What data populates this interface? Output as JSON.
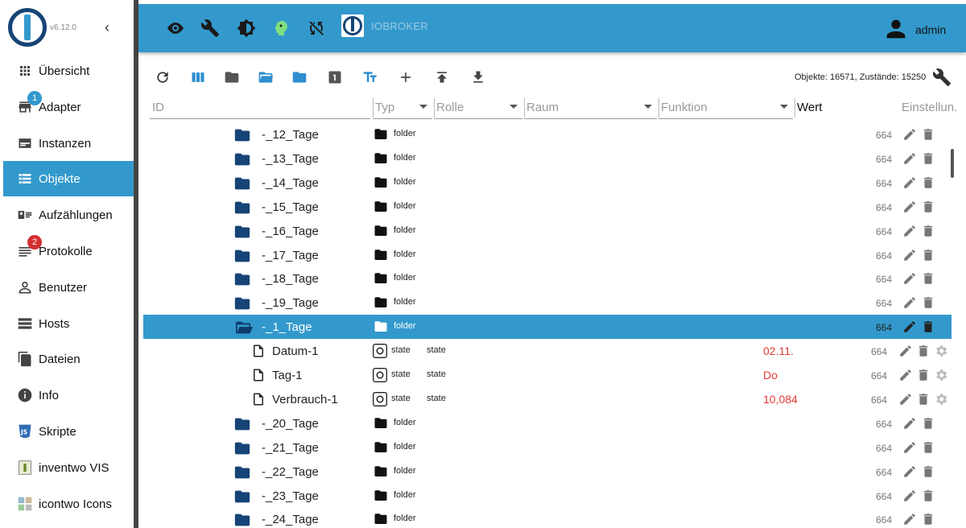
{
  "sidebar": {
    "version": "v6.12.0",
    "items": [
      {
        "label": "Übersicht",
        "icon": "grid-icon"
      },
      {
        "label": "Adapter",
        "icon": "store-icon",
        "badge": "1",
        "badge_color": "#3399cc"
      },
      {
        "label": "Instanzen",
        "icon": "instances-icon"
      },
      {
        "label": "Objekte",
        "icon": "list-icon",
        "active": true
      },
      {
        "label": "Aufzählungen",
        "icon": "enum-icon"
      },
      {
        "label": "Protokolle",
        "icon": "log-icon",
        "badge": "2",
        "badge_color": "#d32f2f"
      },
      {
        "label": "Benutzer",
        "icon": "user-icon"
      },
      {
        "label": "Hosts",
        "icon": "hosts-icon"
      },
      {
        "label": "Dateien",
        "icon": "files-icon"
      },
      {
        "label": "Info",
        "icon": "info-icon"
      },
      {
        "label": "Skripte",
        "icon": "js-icon"
      },
      {
        "label": "inventwo VIS",
        "icon": "inventwo-icon"
      },
      {
        "label": "icontwo Icons",
        "icon": "icontwo-icon"
      }
    ]
  },
  "header": {
    "brand": "IOBROKER",
    "user": "admin"
  },
  "toolbar": {
    "counts": "Objekte: 16571, Zustände: 15250"
  },
  "columns": {
    "id": "ID",
    "typ": "Typ",
    "rolle": "Rolle",
    "raum": "Raum",
    "funktion": "Funktion",
    "wert": "Wert",
    "einstellungen": "Einstellun."
  },
  "rows": [
    {
      "name": "-_12_Tage",
      "kind": "folder",
      "type": "folder",
      "role": "",
      "value": "",
      "acl": "664"
    },
    {
      "name": "-_13_Tage",
      "kind": "folder",
      "type": "folder",
      "role": "",
      "value": "",
      "acl": "664"
    },
    {
      "name": "-_14_Tage",
      "kind": "folder",
      "type": "folder",
      "role": "",
      "value": "",
      "acl": "664"
    },
    {
      "name": "-_15_Tage",
      "kind": "folder",
      "type": "folder",
      "role": "",
      "value": "",
      "acl": "664"
    },
    {
      "name": "-_16_Tage",
      "kind": "folder",
      "type": "folder",
      "role": "",
      "value": "",
      "acl": "664"
    },
    {
      "name": "-_17_Tage",
      "kind": "folder",
      "type": "folder",
      "role": "",
      "value": "",
      "acl": "664"
    },
    {
      "name": "-_18_Tage",
      "kind": "folder",
      "type": "folder",
      "role": "",
      "value": "",
      "acl": "664"
    },
    {
      "name": "-_19_Tage",
      "kind": "folder",
      "type": "folder",
      "role": "",
      "value": "",
      "acl": "664"
    },
    {
      "name": "-_1_Tage",
      "kind": "open-folder",
      "type": "folder",
      "role": "",
      "value": "",
      "acl": "664",
      "selected": true
    },
    {
      "name": "Datum-1",
      "kind": "state",
      "type": "state",
      "role": "state",
      "value": "02.11.",
      "acl": "664"
    },
    {
      "name": "Tag-1",
      "kind": "state",
      "type": "state",
      "role": "state",
      "value": "Do",
      "acl": "664"
    },
    {
      "name": "Verbrauch-1",
      "kind": "state",
      "type": "state",
      "role": "state",
      "value": "10,084",
      "acl": "664"
    },
    {
      "name": "-_20_Tage",
      "kind": "folder",
      "type": "folder",
      "role": "",
      "value": "",
      "acl": "664"
    },
    {
      "name": "-_21_Tage",
      "kind": "folder",
      "type": "folder",
      "role": "",
      "value": "",
      "acl": "664"
    },
    {
      "name": "-_22_Tage",
      "kind": "folder",
      "type": "folder",
      "role": "",
      "value": "",
      "acl": "664"
    },
    {
      "name": "-_23_Tage",
      "kind": "folder",
      "type": "folder",
      "role": "",
      "value": "",
      "acl": "664"
    },
    {
      "name": "-_24_Tage",
      "kind": "folder",
      "type": "folder",
      "role": "",
      "value": "",
      "acl": "664"
    }
  ]
}
